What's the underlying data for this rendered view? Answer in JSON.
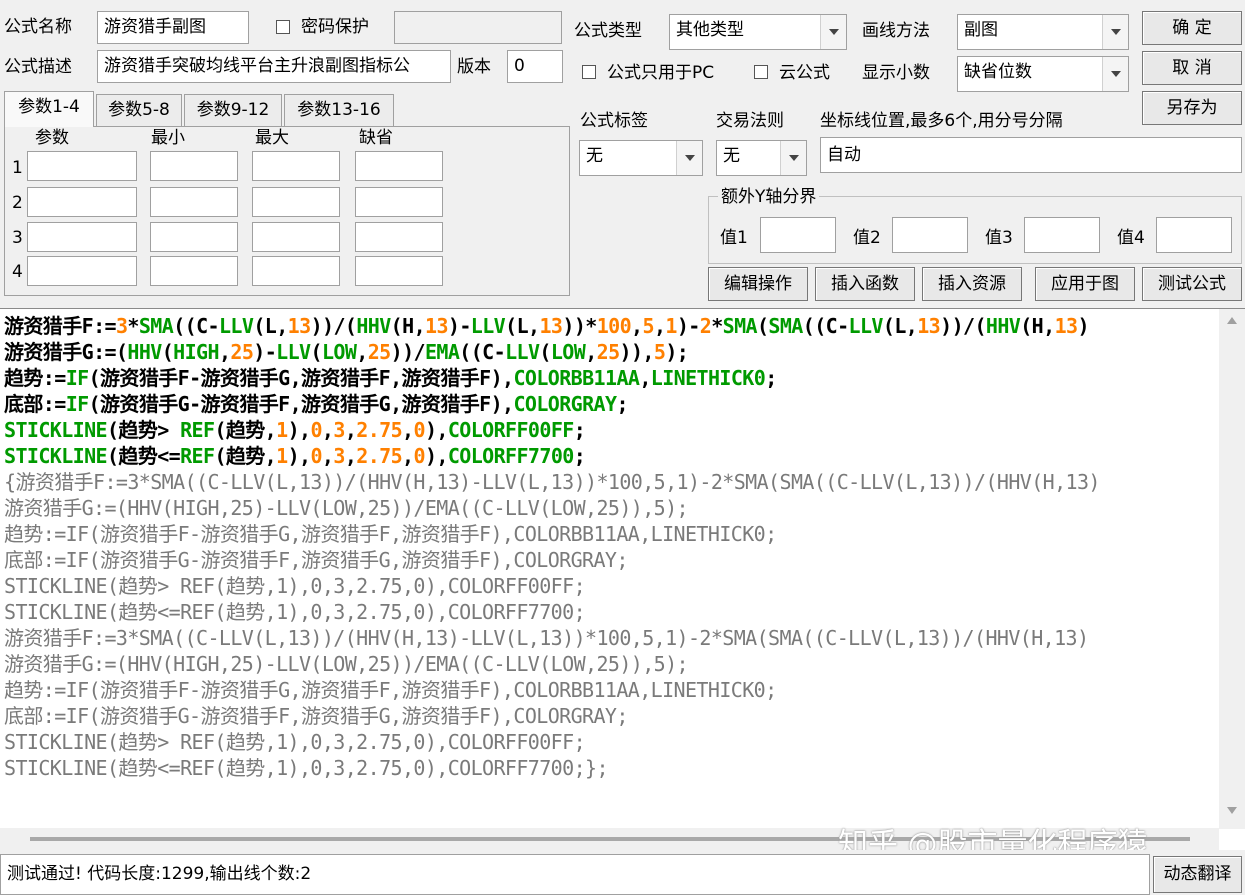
{
  "form": {
    "name_label": "公式名称",
    "name_value": "游资猎手副图",
    "password_label": "密码保护",
    "password_value": "",
    "desc_label": "公式描述",
    "desc_value": "游资猎手突破均线平台主升浪副图指标公",
    "version_label": "版本",
    "version_value": "0",
    "type_label": "公式类型",
    "type_value": "其他类型",
    "draw_label": "画线方法",
    "draw_value": "副图",
    "pc_only_label": "公式只用于PC",
    "cloud_label": "云公式",
    "decimal_label": "显示小数",
    "decimal_value": "缺省位数",
    "tag_label": "公式标签",
    "tag_value": "无",
    "rule_label": "交易法则",
    "rule_value": "无",
    "axis_label": "坐标线位置,最多6个,用分号分隔",
    "axis_value": "自动",
    "y_group_label": "额外Y轴分界",
    "y_vals": [
      "值1",
      "值2",
      "值3",
      "值4"
    ]
  },
  "buttons": {
    "ok": "确 定",
    "cancel": "取 消",
    "save_as": "另存为",
    "edit_ops": "编辑操作",
    "insert_func": "插入函数",
    "insert_res": "插入资源",
    "apply_chart": "应用于图",
    "test_formula": "测试公式",
    "dyn_translate": "动态翻译"
  },
  "params": {
    "tabs": [
      "参数1-4",
      "参数5-8",
      "参数9-12",
      "参数13-16"
    ],
    "headers": [
      "参数",
      "最小",
      "最大",
      "缺省"
    ],
    "rows": [
      "1",
      "2",
      "3",
      "4"
    ]
  },
  "code": {
    "highlighted": [
      "游资猎手F:=3*SMA((C-LLV(L,13))/(HHV(H,13)-LLV(L,13))*100,5,1)-2*SMA(SMA((C-LLV(L,13))/(HHV(H,13)",
      "游资猎手G:=(HHV(HIGH,25)-LLV(LOW,25))/EMA((C-LLV(LOW,25)),5);",
      "趋势:=IF(游资猎手F-游资猎手G,游资猎手F,游资猎手F),COLORBB11AA,LINETHICK0;",
      "底部:=IF(游资猎手G-游资猎手F,游资猎手G,游资猎手F),COLORGRAY;",
      "STICKLINE(趋势> REF(趋势,1),0,3,2.75,0),COLORFF00FF;",
      "STICKLINE(趋势<=REF(趋势,1),0,3,2.75,0),COLORFF7700;"
    ],
    "comment": [
      "{游资猎手F:=3*SMA((C-LLV(L,13))/(HHV(H,13)-LLV(L,13))*100,5,1)-2*SMA(SMA((C-LLV(L,13))/(HHV(H,13)",
      "游资猎手G:=(HHV(HIGH,25)-LLV(LOW,25))/EMA((C-LLV(LOW,25)),5);",
      "趋势:=IF(游资猎手F-游资猎手G,游资猎手F,游资猎手F),COLORBB11AA,LINETHICK0;",
      "底部:=IF(游资猎手G-游资猎手F,游资猎手G,游资猎手F),COLORGRAY;",
      "STICKLINE(趋势> REF(趋势,1),0,3,2.75,0),COLORFF00FF;",
      "STICKLINE(趋势<=REF(趋势,1),0,3,2.75,0),COLORFF7700;",
      "游资猎手F:=3*SMA((C-LLV(L,13))/(HHV(H,13)-LLV(L,13))*100,5,1)-2*SMA(SMA((C-LLV(L,13))/(HHV(H,13)",
      "游资猎手G:=(HHV(HIGH,25)-LLV(LOW,25))/EMA((C-LLV(LOW,25)),5);",
      "趋势:=IF(游资猎手F-游资猎手G,游资猎手F,游资猎手F),COLORBB11AA,LINETHICK0;",
      "底部:=IF(游资猎手G-游资猎手F,游资猎手G,游资猎手F),COLORGRAY;",
      "STICKLINE(趋势> REF(趋势,1),0,3,2.75,0),COLORFF00FF;",
      "STICKLINE(趋势<=REF(趋势,1),0,3,2.75,0),COLORFF7700;};"
    ]
  },
  "status": "测试通过! 代码长度:1299,输出线个数:2",
  "watermark": "知乎 @股市量化程序猿",
  "colors": {
    "function": "#009a00",
    "number": "#ff8000",
    "comment": "#7a7a7a"
  }
}
